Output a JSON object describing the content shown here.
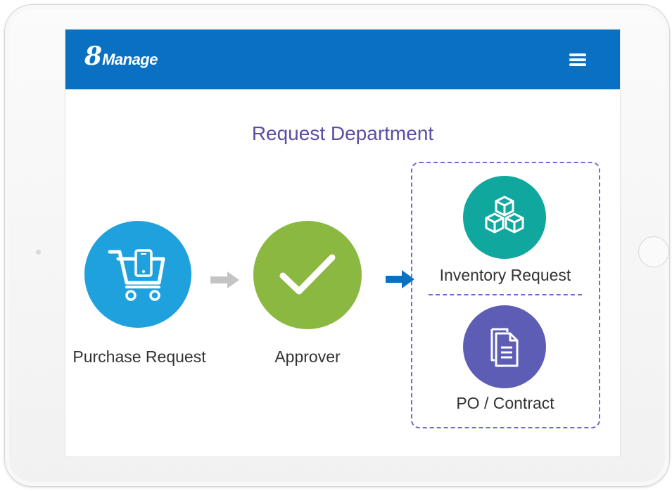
{
  "app": {
    "logo_digit": "8",
    "logo_text": "Manage"
  },
  "header": {
    "menu_icon": "hamburger-menu-icon"
  },
  "page": {
    "title": "Request Department"
  },
  "workflow": {
    "steps": [
      {
        "label": "Purchase Request",
        "icon": "shopping-cart-icon",
        "color": "#1ea1dd"
      },
      {
        "label": "Approver",
        "icon": "checkmark-icon",
        "color": "#8ab841"
      }
    ],
    "outcomes": [
      {
        "label": "Inventory Request",
        "icon": "boxes-icon",
        "color": "#10a79f"
      },
      {
        "label": "PO / Contract",
        "icon": "documents-icon",
        "color": "#5e5db6"
      }
    ]
  },
  "colors": {
    "brand_blue": "#0a70c1",
    "title_purple": "#5a4fa6",
    "dashed_border": "#6f6bd1",
    "arrow_gray": "#c4c4c4",
    "arrow_blue": "#0a70c1"
  }
}
